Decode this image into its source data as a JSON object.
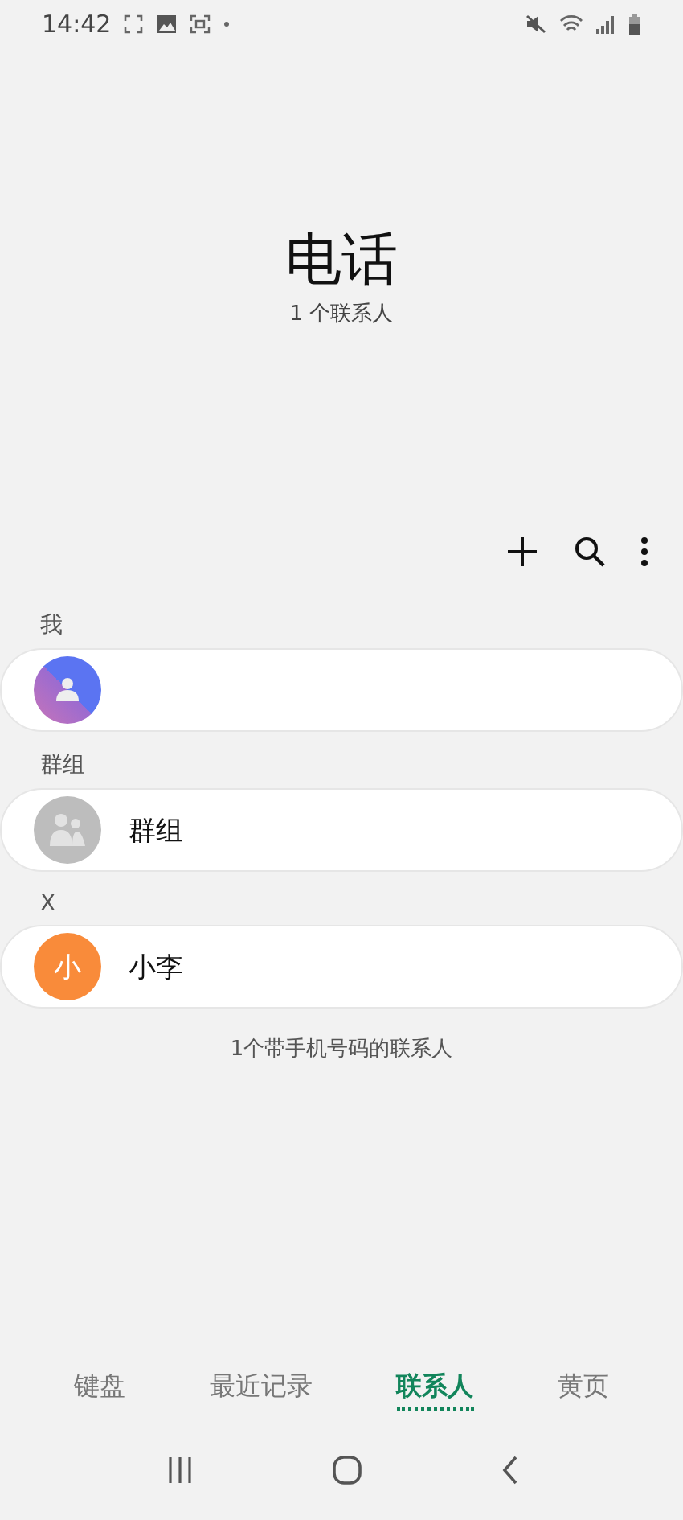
{
  "status_bar": {
    "time": "14:42"
  },
  "header": {
    "title": "电话",
    "subtitle": "1 个联系人"
  },
  "sections": [
    {
      "label": "我",
      "contacts": [
        {
          "kind": "me"
        }
      ]
    },
    {
      "label": "群组",
      "contacts": [
        {
          "kind": "group",
          "name": "群组"
        }
      ]
    },
    {
      "label": "X",
      "contacts": [
        {
          "kind": "letter",
          "initial": "小",
          "name": "小李",
          "color": "#f98b3a"
        }
      ]
    }
  ],
  "footer_note": "1个带手机号码的联系人",
  "tabs": [
    {
      "label": "键盘",
      "selected": false
    },
    {
      "label": "最近记录",
      "selected": false
    },
    {
      "label": "联系人",
      "selected": true
    },
    {
      "label": "黄页",
      "selected": false
    }
  ]
}
